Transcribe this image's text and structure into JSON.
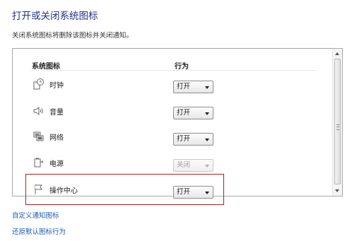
{
  "header": {
    "title": "打开或关闭系统图标",
    "subtitle": "关闭系统图标将删除该图标并关闭通知。"
  },
  "table": {
    "col_icons": "系统图标",
    "col_behavior": "行为",
    "rows": [
      {
        "icon": "clock-icon",
        "label": "时钟",
        "value": "打开",
        "enabled": true
      },
      {
        "icon": "volume-icon",
        "label": "音量",
        "value": "打开",
        "enabled": true
      },
      {
        "icon": "network-icon",
        "label": "网络",
        "value": "打开",
        "enabled": true
      },
      {
        "icon": "power-icon",
        "label": "电源",
        "value": "关闭",
        "enabled": false
      },
      {
        "icon": "action-center-flag-icon",
        "label": "操作中心",
        "value": "打开",
        "enabled": true,
        "highlighted": true
      }
    ]
  },
  "links": {
    "customize": "自定义通知图标",
    "restore": "还原默认图标行为"
  },
  "colors": {
    "title": "#1e3287",
    "link": "#1a5ab8",
    "highlight_border": "#b02020"
  }
}
